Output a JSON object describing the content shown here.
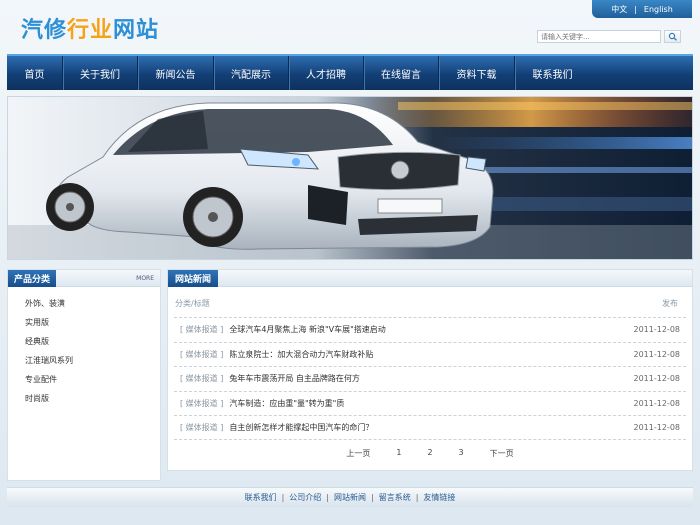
{
  "site": {
    "logo_part1": "汽修",
    "logo_part2": "行业",
    "logo_part3": "网站"
  },
  "lang": {
    "zh": "中文",
    "sep": "|",
    "en": "English"
  },
  "search": {
    "placeholder": "请输入关键字..."
  },
  "nav": [
    "首页",
    "关于我们",
    "新闻公告",
    "汽配展示",
    "人才招聘",
    "在线留言",
    "资料下载",
    "联系我们"
  ],
  "sidebar": {
    "title": "产品分类",
    "more": "MORE",
    "items": [
      "外饰、装潢",
      "实用版",
      "经典版",
      "江淮瑞风系列",
      "专业配件",
      "时尚版"
    ]
  },
  "news": {
    "title": "网站新闻",
    "col_title": "分类/标题",
    "col_date": "发布",
    "items": [
      {
        "cat": "[ 媒体报道 ]",
        "title": "全球汽车4月聚焦上海 新浪\"V车展\"搭速启动",
        "date": "2011-12-08"
      },
      {
        "cat": "[ 媒体报道 ]",
        "title": "陈立泉院士：加大混合动力汽车财政补贴",
        "date": "2011-12-08"
      },
      {
        "cat": "[ 媒体报道 ]",
        "title": "兔年车市震荡开局 自主品牌路在何方",
        "date": "2011-12-08"
      },
      {
        "cat": "[ 媒体报道 ]",
        "title": "汽车制造：应由重\"量\"转为重\"质",
        "date": "2011-12-08"
      },
      {
        "cat": "[ 媒体报道 ]",
        "title": "自主创新怎样才能撑起中国汽车的命门？",
        "date": "2011-12-08"
      }
    ],
    "pager": {
      "prev": "上一页",
      "p1": "1",
      "p2": "2",
      "p3": "3",
      "next": "下一页"
    }
  },
  "footer": [
    "联系我们",
    "公司介绍",
    "网站新闻",
    "留言系统",
    "友情链接"
  ],
  "colors": {
    "nav_dark": "#133f76",
    "accent_blue": "#2d8fd6",
    "accent_orange": "#f5a316"
  }
}
